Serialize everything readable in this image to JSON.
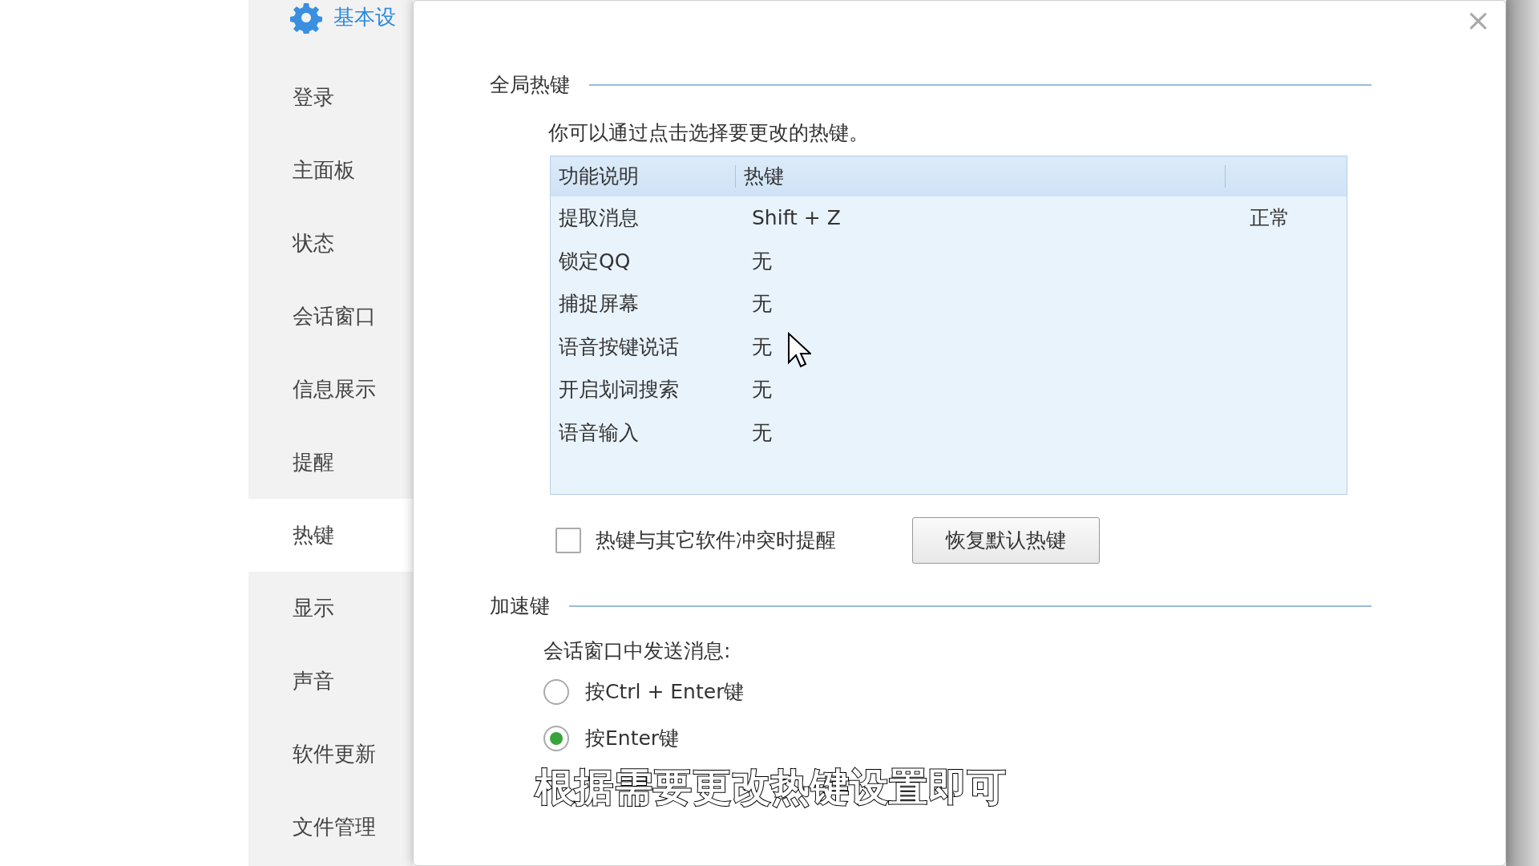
{
  "sidebar": {
    "header": {
      "label": "基本设"
    },
    "items": [
      {
        "label": "登录",
        "selected": false
      },
      {
        "label": "主面板",
        "selected": false
      },
      {
        "label": "状态",
        "selected": false
      },
      {
        "label": "会话窗口",
        "selected": false
      },
      {
        "label": "信息展示",
        "selected": false
      },
      {
        "label": "提醒",
        "selected": false
      },
      {
        "label": "热键",
        "selected": true
      },
      {
        "label": "显示",
        "selected": false
      },
      {
        "label": "声音",
        "selected": false
      },
      {
        "label": "软件更新",
        "selected": false
      },
      {
        "label": "文件管理",
        "selected": false
      }
    ]
  },
  "dialog": {
    "close": "×",
    "global_hotkeys": {
      "title": "全局热键",
      "description": "你可以通过点击选择要更改的热键。",
      "table": {
        "columns": [
          "功能说明",
          "热键"
        ],
        "rows": [
          {
            "function": "提取消息",
            "hotkey": "Shift + Z",
            "status": "正常"
          },
          {
            "function": "锁定QQ",
            "hotkey": "无"
          },
          {
            "function": "捕捉屏幕",
            "hotkey": "无"
          },
          {
            "function": "语音按键说话",
            "hotkey": "无"
          },
          {
            "function": "开启划词搜索",
            "hotkey": "无"
          },
          {
            "function": "语音输入",
            "hotkey": "无"
          }
        ]
      },
      "conflict_alert": {
        "label": "热键与其它软件冲突时提醒",
        "checked": false
      },
      "restore_button": "恢复默认热键"
    },
    "accelerators": {
      "title": "加速键",
      "prompt": "会话窗口中发送消息:",
      "options": [
        {
          "label": "按Ctrl + Enter键",
          "selected": false
        },
        {
          "label": "按Enter键",
          "selected": true
        }
      ]
    }
  },
  "caption": "根据需要更改热键设置即可"
}
